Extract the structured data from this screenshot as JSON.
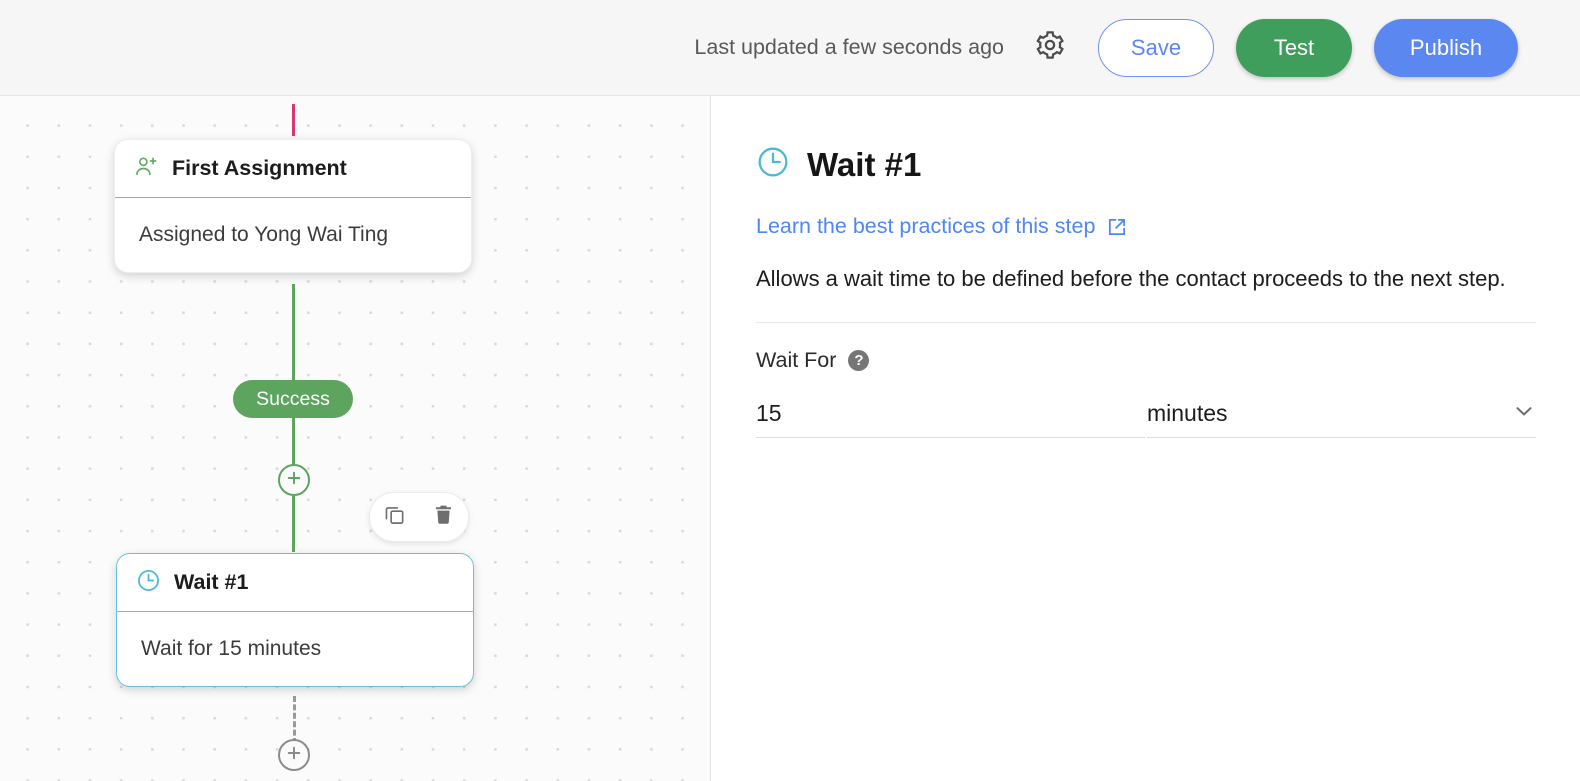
{
  "topbar": {
    "updated_text": "Last updated a few seconds ago",
    "gear_icon": "gear-icon",
    "save_label": "Save",
    "test_label": "Test",
    "publish_label": "Publish",
    "colors": {
      "save_blue": "#5b87f0",
      "test_green": "#3f9e5c",
      "publish_blue": "#5b87f0"
    }
  },
  "canvas": {
    "nodes": [
      {
        "icon": "person-add-icon",
        "title": "First Assignment",
        "body": "Assigned to Yong Wai Ting",
        "accent": "#7dbd7e",
        "selected": false
      },
      {
        "icon": "clock-icon",
        "title": "Wait #1",
        "body": "Wait for 15 minutes",
        "accent": "#66c3dc",
        "selected": true
      }
    ],
    "branch_label": "Success",
    "add_step_icon": "plus-circle-icon",
    "toolbar": {
      "copy_icon": "copy-icon",
      "delete_icon": "trash-icon"
    },
    "connector_colors": {
      "incoming": "#d9386b",
      "success": "#5da55f",
      "pending": "#9a9a9a"
    }
  },
  "panel": {
    "icon": "clock-icon",
    "title": "Wait #1",
    "link_text": "Learn the best practices of this step",
    "link_icon": "external-link-icon",
    "description": "Allows a wait time to be defined before the contact proceeds to the next step.",
    "field": {
      "label": "Wait For",
      "help_icon": "help-circle-icon",
      "amount_value": "15",
      "amount_placeholder": "",
      "unit_value": "minutes",
      "unit_chevron_icon": "chevron-down-icon"
    }
  }
}
